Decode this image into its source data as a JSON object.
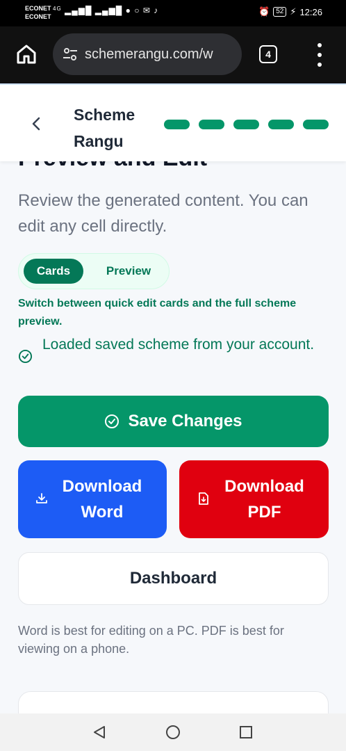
{
  "status_bar": {
    "carrier_1": "ECONET",
    "carrier_2": "ECONET",
    "signal_text": "4G",
    "battery": "52",
    "time": "12:26"
  },
  "browser": {
    "url": "schemerangu.com/w",
    "tab_count": "4"
  },
  "header": {
    "brand": "Scheme Rangu",
    "steps_completed": 5,
    "steps_total": 5,
    "step_color": "#059669"
  },
  "page": {
    "title": "Preview and Edit",
    "subtitle": "Review the generated content. You can edit any cell directly.",
    "toggle": {
      "cards_label": "Cards",
      "preview_label": "Preview",
      "selected": "Cards"
    },
    "hint": "Switch between quick edit cards and the full scheme preview.",
    "status_message": "Loaded saved scheme from your account."
  },
  "actions": {
    "save_label": "Save Changes",
    "word_label": "Download Word",
    "pdf_label": "Download PDF",
    "dashboard_label": "Dashboard"
  },
  "footnote": "Word is best for editing on a PC. PDF is best for viewing on a phone.",
  "colors": {
    "primary_green": "#059669",
    "word_blue": "#1d5cf5",
    "pdf_red": "#e0000f"
  },
  "icons": [
    "home-icon",
    "tune-icon",
    "check-circle-icon",
    "download-icon",
    "pdf-file-icon",
    "back-chevron-icon",
    "nav-back-icon",
    "nav-home-icon",
    "nav-recents-icon"
  ]
}
